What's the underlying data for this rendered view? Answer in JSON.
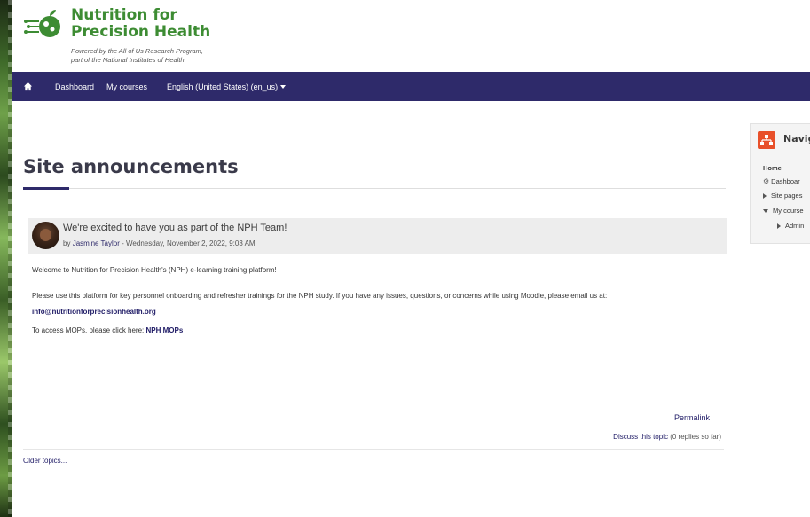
{
  "brand": {
    "title_line1": "Nutrition for",
    "title_line2": "Precision Health",
    "subtitle_line1": "Powered by the All of Us Research Program,",
    "subtitle_line2": "part of the National Institutes of Health",
    "color": "#3d8c33"
  },
  "navbar": {
    "home_icon": "home-icon",
    "items": [
      {
        "label": "Dashboard"
      },
      {
        "label": "My courses"
      },
      {
        "label": "English (United States) (en_us)"
      }
    ],
    "color": "#2e2a6a"
  },
  "page": {
    "title": "Site announcements"
  },
  "post": {
    "subject": "We're excited to have you as part of the NPH Team!",
    "by": "by",
    "author": "Jasmine Taylor",
    "date": " - Wednesday, November 2, 2022, 9:03 AM",
    "paragraph1": "Welcome to Nutrition for Precision Health's (NPH) e-learning training platform!",
    "paragraph2_text": "Please use this platform for key personnel onboarding and refresher trainings for the NPH study. If you have any issues, questions, or concerns while using Moodle, please email us at: ",
    "paragraph2_link": "info@nutritionforprecisionhealth.org",
    "paragraph3_text": "To access MOPs, please click here: ",
    "paragraph3_link": "NPH MOPs",
    "permalink": "Permalink",
    "discuss_link": "Discuss this topic",
    "discuss_count": " (0 replies so far)"
  },
  "older_topics": "Older topics...",
  "navigation_block": {
    "title": "Navig",
    "home": "Home",
    "items": [
      {
        "label": "Dashboar",
        "icon": "gear-icon"
      },
      {
        "label": "Site pages",
        "icon": "expand-icon"
      },
      {
        "label": "My course",
        "icon": "collapse-icon"
      },
      {
        "label": "Admin",
        "icon": "expand-icon"
      }
    ],
    "accent": "#e8502a"
  }
}
